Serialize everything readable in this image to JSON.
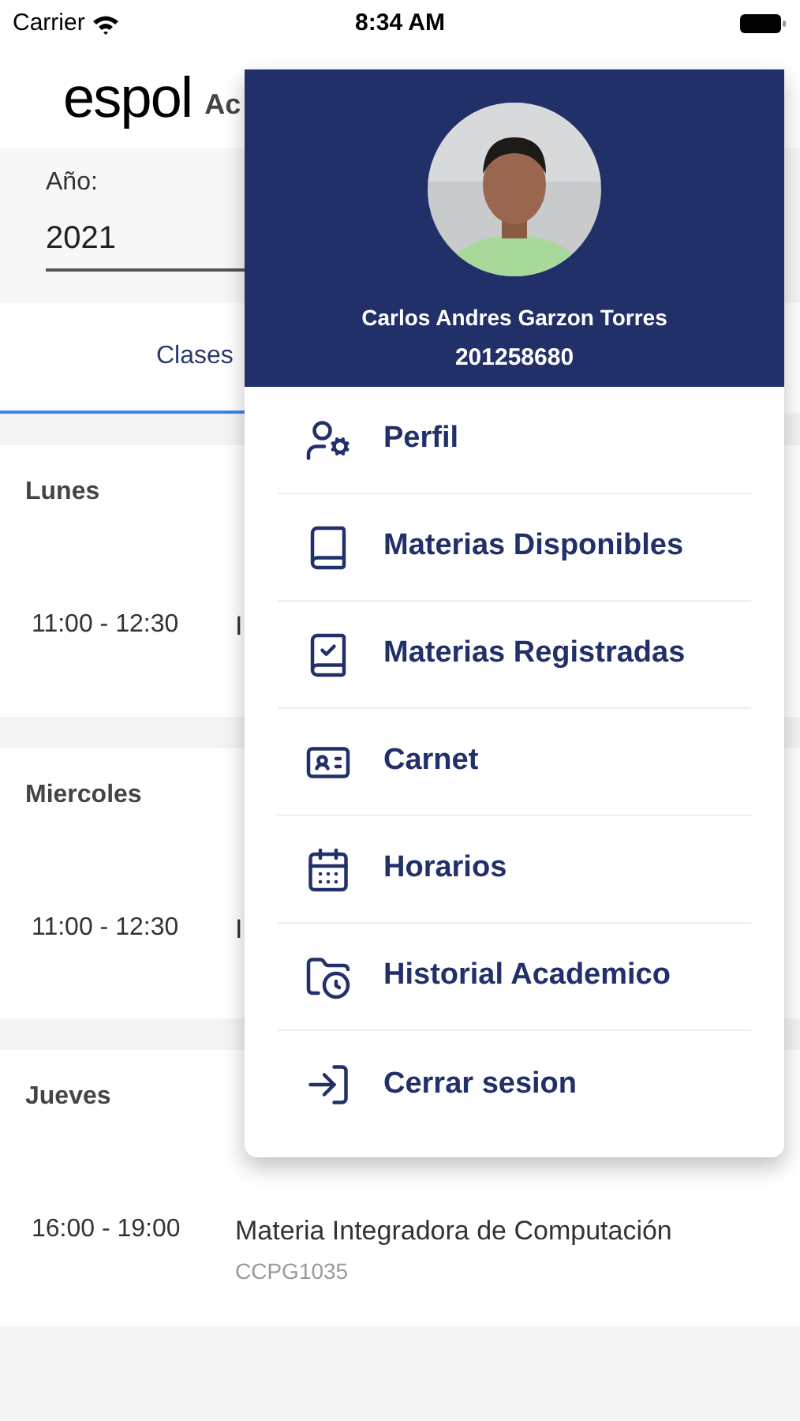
{
  "status_bar": {
    "carrier": "Carrier",
    "time": "8:34 AM"
  },
  "header": {
    "logo": "espol",
    "title": "Ac"
  },
  "year": {
    "label": "Año:",
    "value": "2021"
  },
  "tabs": [
    {
      "label": "Clases",
      "selected": true
    }
  ],
  "days": [
    {
      "day": "Lunes",
      "classes": [
        {
          "time": "11:00 - 12:30",
          "name": "I"
        }
      ]
    },
    {
      "day": "Miercoles",
      "classes": [
        {
          "time": "11:00 - 12:30",
          "name": "I"
        }
      ]
    },
    {
      "day": "Jueves",
      "classes": [
        {
          "time": "16:00 - 19:00",
          "name": "Materia Integradora de Computación",
          "code": "CCPG1035"
        }
      ]
    }
  ],
  "menu": {
    "user": {
      "kind": "picture",
      "name": "Carlos Andres Garzon Torres",
      "id": "201258680"
    },
    "items": [
      {
        "kind": "profile",
        "label": "Perfil"
      },
      {
        "kind": "subjects",
        "label": "Materias Disponibles"
      },
      {
        "kind": "registered",
        "label": "Materias Registradas"
      },
      {
        "kind": "card",
        "label": "Carnet"
      },
      {
        "kind": "schedule",
        "label": "Horarios"
      },
      {
        "kind": "history",
        "label": "Historial Academico"
      },
      {
        "kind": "logout",
        "label": "Cerrar sesion"
      }
    ]
  }
}
